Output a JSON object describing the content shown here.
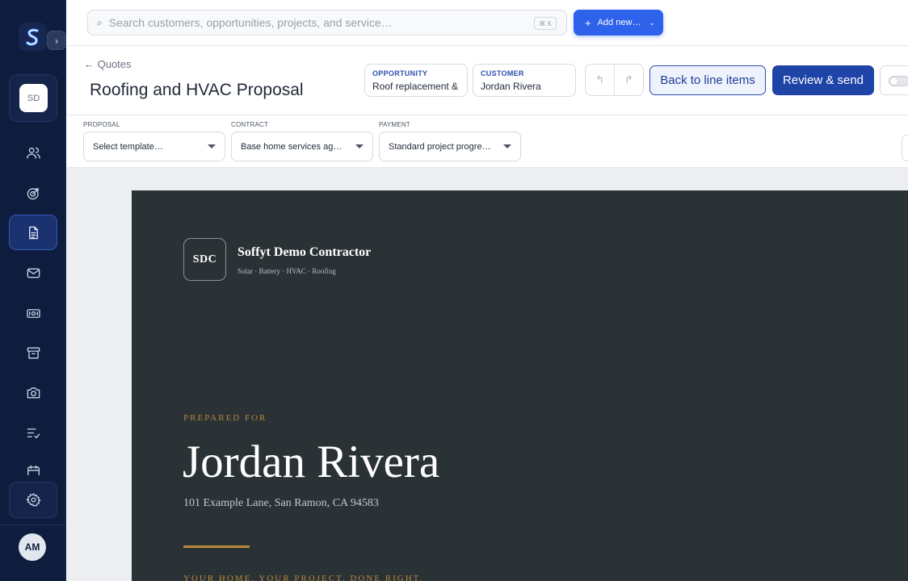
{
  "app": {
    "workspace_initials": "SD",
    "user_initials": "AM",
    "accent_color": "#2f62ea",
    "sidebar_color": "#0e1c3d"
  },
  "sidebar": {
    "items": [
      {
        "icon": "users-icon"
      },
      {
        "icon": "target-icon"
      },
      {
        "icon": "document-icon",
        "active": true
      },
      {
        "icon": "mail-icon"
      },
      {
        "icon": "money-icon"
      },
      {
        "icon": "archive-icon"
      },
      {
        "icon": "camera-icon"
      },
      {
        "icon": "checklist-icon"
      },
      {
        "icon": "calendar-icon"
      }
    ],
    "settings_icon": "gear-icon"
  },
  "topbar": {
    "search_placeholder": "Search customers, opportunities, projects, and service…",
    "search_shortcut": "⌘ K",
    "add_new_label": "Add new…"
  },
  "header": {
    "back_label": "← Quotes",
    "title": "Roofing and HVAC Proposal",
    "opportunity_label": "OPPORTUNITY",
    "opportunity_value": "Roof replacement &",
    "customer_label": "CUSTOMER",
    "customer_value": "Jordan Rivera",
    "back_to_line_items": "Back to line items",
    "review_send": "Review & send"
  },
  "selectors": {
    "proposal_label": "PROPOSAL",
    "proposal_value": "Select template…",
    "contract_label": "CONTRACT",
    "contract_value": "Base home services ag…",
    "payment_label": "PAYMENT",
    "payment_value": "Standard project progre…"
  },
  "document": {
    "logo_initials": "SDC",
    "company_name": "Soffyt Demo Contractor",
    "tagline": "Solar · Battery · HVAC · Roofing",
    "prepared_for": "PREPARED FOR",
    "customer_name": "Jordan Rivera",
    "address": "101 Example Lane, San Ramon, CA 94583",
    "slogan": "YOUR HOME. YOUR PROJECT. DONE RIGHT.",
    "accent_color": "#b8863c"
  }
}
